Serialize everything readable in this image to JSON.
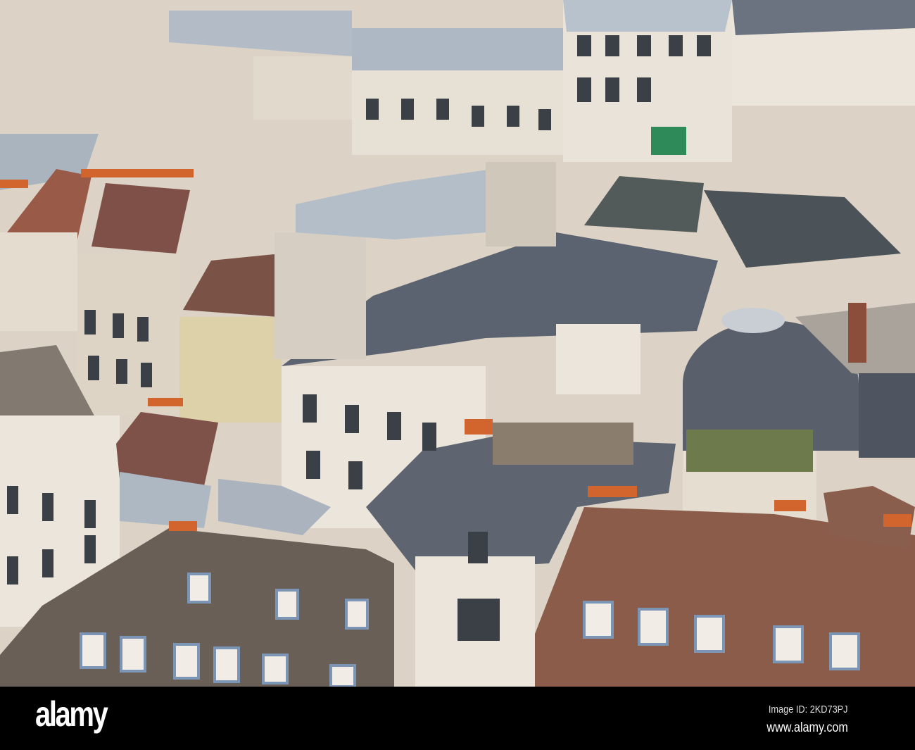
{
  "watermark": {
    "logo": "alamy",
    "image_id": "Image ID: 2KD73PJ",
    "url": "www.alamy.com"
  },
  "colors": {
    "wall": "#e6ddd0",
    "slate_roof": "#5d6470",
    "zinc_roof": "#b9c2cc",
    "tile_roof": "#8a5a48",
    "chimney_pot": "#d2652e",
    "bar": "#000000"
  }
}
